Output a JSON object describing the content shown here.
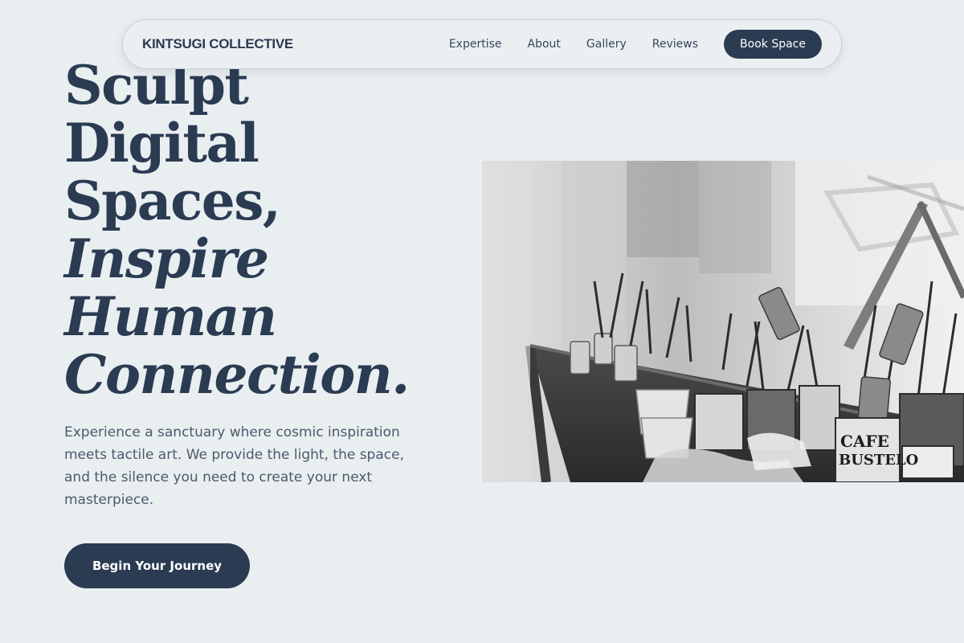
{
  "header": {
    "brand": "KINTSUGI COLLECTIVE",
    "nav": [
      {
        "label": "Expertise"
      },
      {
        "label": "About"
      },
      {
        "label": "Gallery"
      },
      {
        "label": "Reviews"
      }
    ],
    "cta_label": "Book Space"
  },
  "hero": {
    "title_lines": [
      "Sculpt",
      "Digital",
      "Spaces,",
      "Inspire",
      "Human",
      "Connection."
    ],
    "description": "Experience a sanctuary where cosmic inspiration meets tactile art. We provide the light, the space, and the silence you need to create your next masterpiece.",
    "cta_label": "Begin Your Journey"
  },
  "image": {
    "can_label_1": "CAFE",
    "can_label_2": "BUSTELO"
  },
  "colors": {
    "background": "#e9eef0",
    "primary": "#2a3b52",
    "text_muted": "#4a5a6c"
  }
}
